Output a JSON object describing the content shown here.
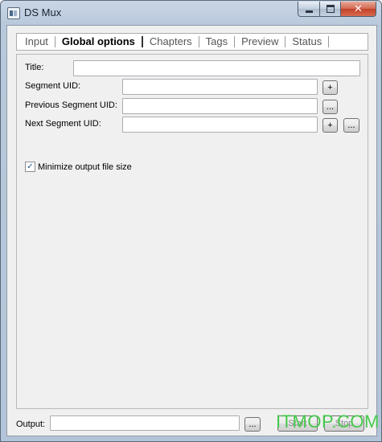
{
  "window": {
    "title": "DS Mux",
    "minimize_glyph": "",
    "maximize_glyph": "",
    "close_glyph": "✕"
  },
  "tabs": [
    {
      "label": "Input"
    },
    {
      "label": "Global options"
    },
    {
      "label": "Chapters"
    },
    {
      "label": "Tags"
    },
    {
      "label": "Preview"
    },
    {
      "label": "Status"
    }
  ],
  "global_options": {
    "title_label": "Title:",
    "title_value": "",
    "segment_uid_label": "Segment UID:",
    "segment_uid_value": "",
    "segment_uid_add": "+",
    "prev_segment_uid_label": "Previous Segment UID:",
    "prev_segment_uid_value": "",
    "prev_segment_uid_browse": "...",
    "next_segment_uid_label": "Next Segment UID:",
    "next_segment_uid_value": "",
    "next_segment_uid_add": "+",
    "next_segment_uid_browse": "...",
    "minimize_label": "Minimize output file size",
    "minimize_checked": true,
    "check_glyph": "✓"
  },
  "bottom": {
    "output_label": "Output:",
    "output_value": "",
    "browse_label": "...",
    "start_label": "Start",
    "stop_label": "Stop"
  },
  "watermark": "ITMOP.COM",
  "colors": {
    "watermark": "#44c94a",
    "title_bar": "#c4d3e4",
    "close_button": "#c94a30"
  }
}
